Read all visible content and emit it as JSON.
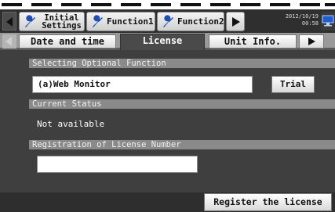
{
  "top_tabs": {
    "initial_settings": "Initial Settings",
    "function1": "Function1",
    "function2": "Function2"
  },
  "datetime": {
    "date": "2012/10/19",
    "time": "00:58"
  },
  "sub_tabs": {
    "date_time": "Date and time",
    "license": "License",
    "unit_info": "Unit Info."
  },
  "optional_function": {
    "header": "Selecting Optional Function",
    "value": "(a)Web Monitor",
    "trial_label": "Trial"
  },
  "current_status": {
    "header": "Current Status",
    "value": "Not available"
  },
  "registration": {
    "header": "Registration of License Number",
    "value": ""
  },
  "footer": {
    "register_label": "Register the license"
  },
  "icons": {
    "prev": "arrow-left-icon",
    "next": "play-right-icon",
    "tool": "wrench-icon",
    "monitor": "monitor-icon"
  }
}
